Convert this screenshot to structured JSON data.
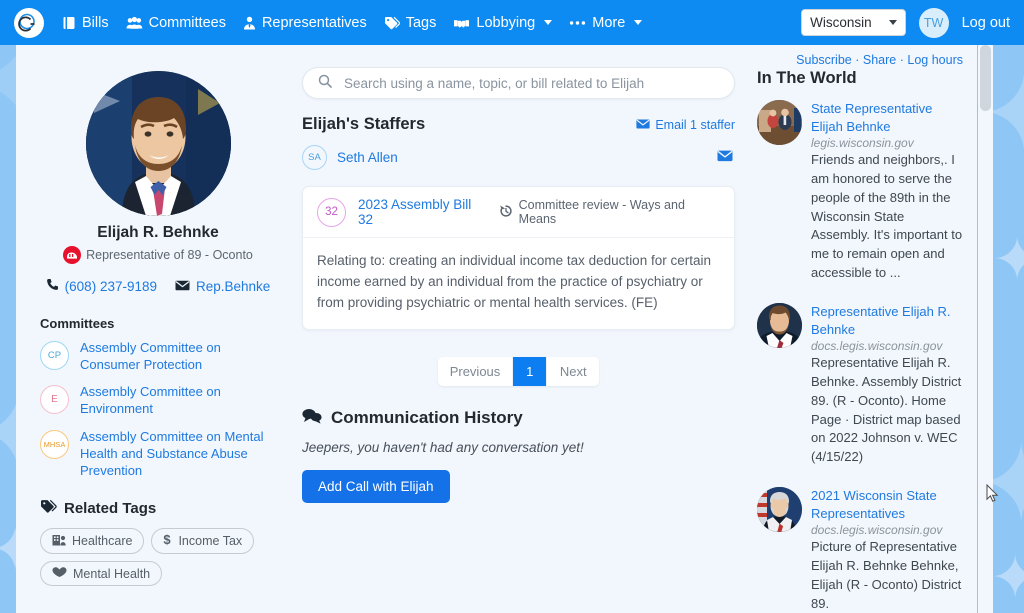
{
  "navbar": {
    "logo_text": "OG",
    "links": [
      {
        "label": "Bills",
        "icon": "book-icon",
        "has_caret": false
      },
      {
        "label": "Committees",
        "icon": "users-icon",
        "has_caret": false
      },
      {
        "label": "Representatives",
        "icon": "person-tie-icon",
        "has_caret": false
      },
      {
        "label": "Tags",
        "icon": "tag-icon",
        "has_caret": false
      },
      {
        "label": "Lobbying",
        "icon": "handshake-icon",
        "has_caret": true
      },
      {
        "label": "More",
        "icon": "ellipsis-icon",
        "has_caret": true
      }
    ],
    "state": "Wisconsin",
    "avatar_initials": "TW",
    "logout_label": "Log out"
  },
  "profile": {
    "name": "Elijah R. Behnke",
    "role": "Representative of 89 - Oconto",
    "party_color": "#e8112d",
    "phone": "(608) 237-9189",
    "email_label": "Rep.Behnke",
    "committees_title": "Committees",
    "committees": [
      {
        "initials": "CP",
        "name": "Assembly Committee on Consumer Protection",
        "color": "#9fd8f5"
      },
      {
        "initials": "E",
        "name": "Assembly Committee on Environment",
        "color": "#f6c0cf"
      },
      {
        "initials": "MHSA",
        "name": "Assembly Committee on Mental Health and Substance Abuse Prevention",
        "color": "#fbc97f"
      }
    ],
    "tags_title": "Related Tags",
    "tags": [
      {
        "label": "Healthcare",
        "icon": "hospital-icon"
      },
      {
        "label": "Income Tax",
        "icon": "dollar-icon"
      },
      {
        "label": "Mental Health",
        "icon": "brain-icon"
      }
    ]
  },
  "main": {
    "search_placeholder": "Search using a name, topic, or bill related to Elijah",
    "search_value": "",
    "staffers_title": "Elijah's Staffers",
    "email_staffers_label": "Email 1 staffer",
    "staffers": [
      {
        "initials": "SA",
        "name": "Seth Allen"
      }
    ],
    "bill": {
      "number": "32",
      "title": "2023 Assembly Bill 32",
      "status": "Committee review - Ways and Means",
      "description": "Relating to: creating an individual income tax deduction for certain income earned by an individual from the practice of psychiatry or from providing psychiatric or mental health services. (FE)"
    },
    "pagination": {
      "previous_label": "Previous",
      "pages": [
        "1"
      ],
      "current_page": "1",
      "next_label": "Next"
    },
    "communication": {
      "title": "Communication History",
      "empty_message": "Jeepers, you haven't had any conversation yet!",
      "add_call_label": "Add Call with Elijah"
    }
  },
  "sidebar_right": {
    "util_links": [
      "Subscribe",
      "Share",
      "Log hours"
    ],
    "separator": "·",
    "title": "In The World",
    "news": [
      {
        "title": "State Representative Elijah Behnke",
        "source": "legis.wisconsin.gov",
        "description": "Friends and neighbors,. I am honored to serve the people of the 89th in the Wisconsin State Assembly. It's important to me to remain open and accessible to ..."
      },
      {
        "title": "Representative Elijah R. Behnke",
        "source": "docs.legis.wisconsin.gov",
        "description": "Representative Elijah R. Behnke. Assembly District 89. (R - Oconto). Home Page · District map based on 2022 Johnson v. WEC (4/15/22)"
      },
      {
        "title": "2021 Wisconsin State Representatives",
        "source": "docs.legis.wisconsin.gov",
        "description": "Picture of Representative Elijah R. Behnke Behnke, Elijah (R - Oconto) District 89."
      }
    ]
  },
  "colors": {
    "brand_blue": "#0d8bf2",
    "link_blue": "#1f7ae0",
    "page_bg": "#f2f7fd",
    "outer_bg": "#8ec6f5"
  }
}
